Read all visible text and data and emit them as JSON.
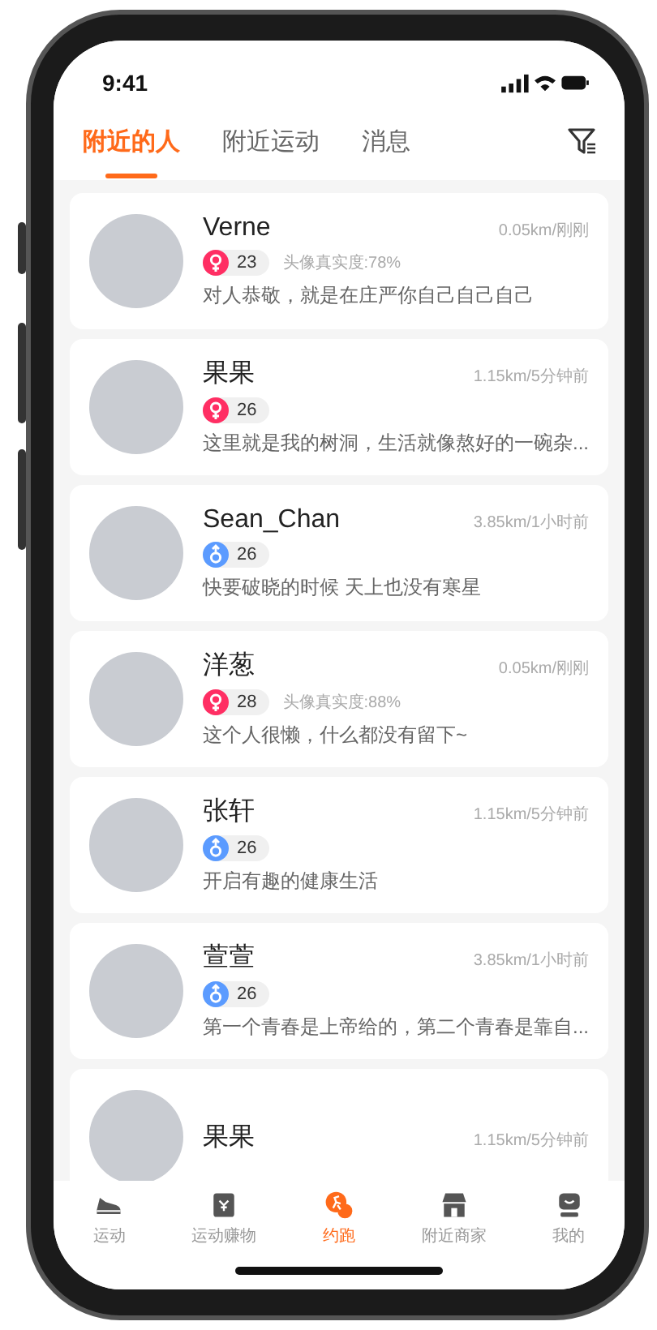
{
  "status_bar": {
    "time": "9:41"
  },
  "tabs": [
    {
      "label": "附近的人",
      "selected": true
    },
    {
      "label": "附近运动",
      "selected": false
    },
    {
      "label": "消息",
      "selected": false
    }
  ],
  "users": [
    {
      "name": "Verne",
      "kind": "female",
      "age": "23",
      "authenticity": "头像真实度:78%",
      "distance": "0.05km/刚刚",
      "bio": "对人恭敬，就是在庄严你自己自己自己"
    },
    {
      "name": "果果",
      "kind": "female",
      "age": "26",
      "distance": "1.15km/5分钟前",
      "bio": "这里就是我的树洞，生活就像熬好的一碗杂..."
    },
    {
      "name": "Sean_Chan",
      "kind": "male",
      "age": "26",
      "distance": "3.85km/1小时前",
      "bio": "快要破晓的时候  天上也没有寒星"
    },
    {
      "name": "洋葱",
      "kind": "female",
      "age": "28",
      "authenticity": "头像真实度:88%",
      "distance": "0.05km/刚刚",
      "bio": "这个人很懒，什么都没有留下~"
    },
    {
      "name": "张轩",
      "kind": "male",
      "age": "26",
      "distance": "1.15km/5分钟前",
      "bio": "开启有趣的健康生活"
    },
    {
      "name": "萱萱",
      "kind": "male",
      "age": "26",
      "distance": "3.85km/1小时前",
      "bio": "第一个青春是上帝给的，第二个青春是靠自..."
    },
    {
      "name": "果果",
      "distance": "1.15km/5分钟前"
    }
  ],
  "bottom_nav": [
    {
      "label": "运动",
      "kind": "shoe",
      "selected": false
    },
    {
      "label": "运动赚物",
      "kind": "bag",
      "selected": false
    },
    {
      "label": "约跑",
      "kind": "run",
      "selected": true
    },
    {
      "label": "附近商家",
      "kind": "shop",
      "selected": false
    },
    {
      "label": "我的",
      "kind": "me",
      "selected": false
    }
  ]
}
